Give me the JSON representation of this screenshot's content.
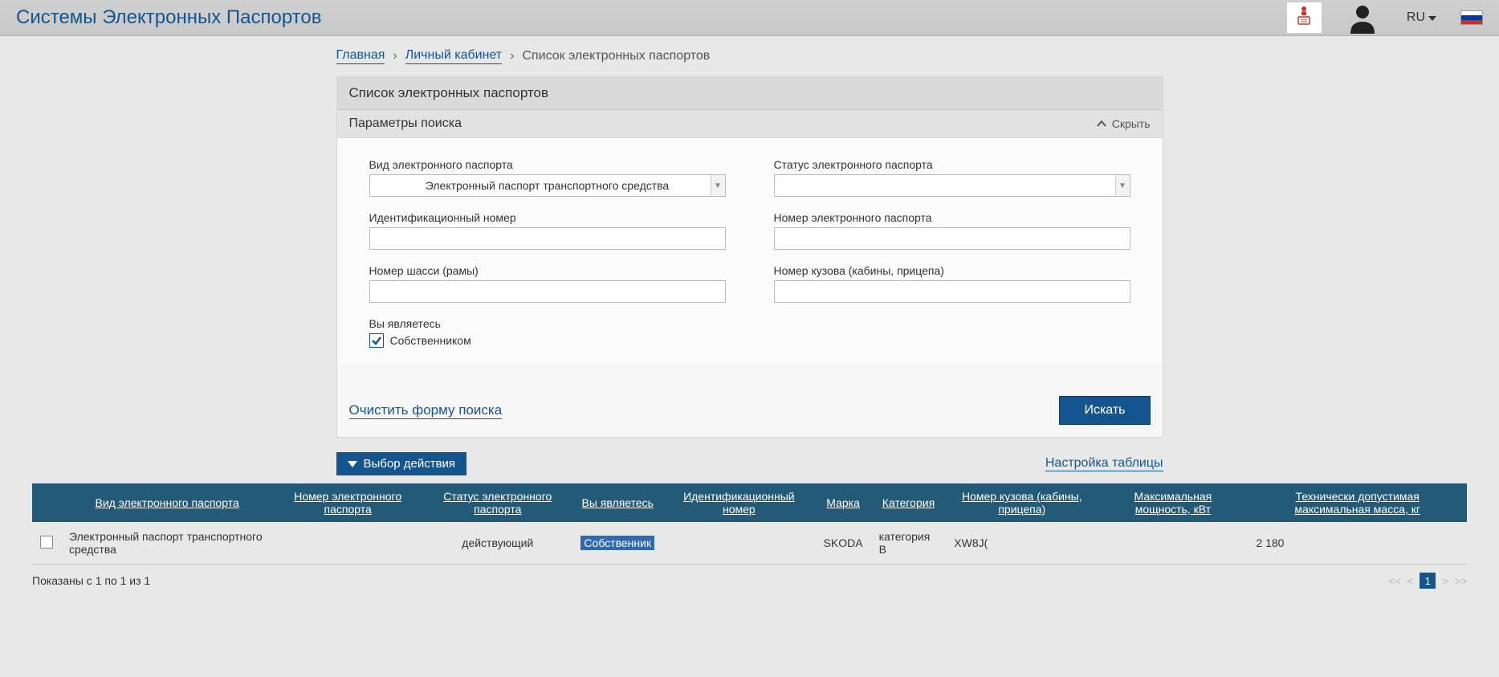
{
  "header": {
    "site_title": "Системы Электронных Паспортов",
    "lang": "RU"
  },
  "breadcrumb": {
    "home": "Главная",
    "account": "Личный кабинет",
    "current": "Список электронных паспортов"
  },
  "panel": {
    "title": "Список электронных паспортов",
    "search_params": "Параметры поиска",
    "hide": "Скрыть"
  },
  "form": {
    "labels": {
      "passport_type": "Вид электронного паспорта",
      "status": "Статус электронного паспорта",
      "ident_number": "Идентификационный номер",
      "passport_number": "Номер электронного паспорта",
      "chassis": "Номер шасси (рамы)",
      "body_number": "Номер кузова (кабины, прицепа)",
      "you_are": "Вы являетесь",
      "owner": "Собственником"
    },
    "values": {
      "passport_type": "Электронный паспорт транспортного средства",
      "status": "",
      "ident_number": "",
      "passport_number": "",
      "chassis": "",
      "body_number": ""
    },
    "clear": "Очистить форму поиска",
    "search": "Искать"
  },
  "midbar": {
    "action_select": "Выбор действия",
    "table_settings": "Настройка таблицы"
  },
  "table": {
    "headers": {
      "type": "Вид электронного паспорта",
      "number": "Номер электронного паспорта",
      "status": "Статус электронного паспорта",
      "you_are": "Вы являетесь",
      "ident": "Идентификационный номер",
      "brand": "Марка",
      "category": "Категория",
      "body": "Номер кузова (кабины, прицепа)",
      "power": "Максимальная мощность, кВт",
      "mass": "Технически допустимая максимальная масса, кг"
    },
    "rows": [
      {
        "type": "Электронный паспорт транспортного средства",
        "number": "",
        "status": "действующий",
        "you_are": "Собственник",
        "ident": "",
        "brand": "SKODA",
        "category": "категория B",
        "body": "XW8J(",
        "power": "",
        "mass": "2 180"
      }
    ]
  },
  "footer": {
    "summary": "Показаны с 1 по 1 из 1",
    "pager": {
      "first": "<<",
      "prev": "<",
      "page": "1",
      "next": ">",
      "last": ">>"
    }
  }
}
